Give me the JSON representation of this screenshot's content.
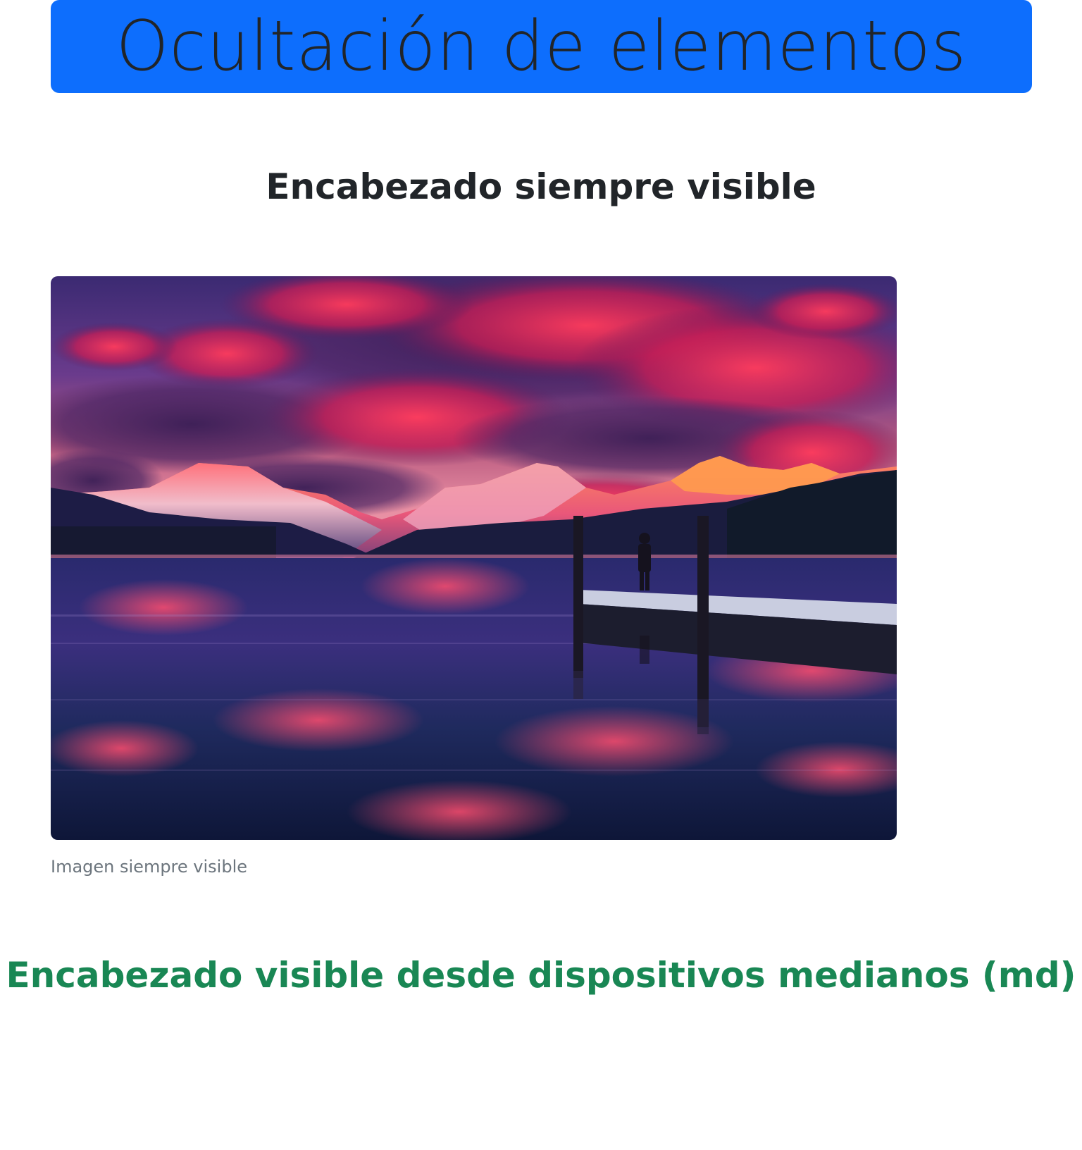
{
  "banner": {
    "title": "Ocultación de elementos",
    "background_color": "#0d6efd"
  },
  "heading_always": {
    "text": "Encabezado siempre visible"
  },
  "image_block": {
    "image_subject": "sunset-lake-mountains-pier-photo",
    "caption": "Imagen siempre visible"
  },
  "heading_md": {
    "text": "Encabezado visible desde dispositivos medianos (md)",
    "color": "#198754"
  },
  "colors": {
    "text": "#212529",
    "muted": "#6c757d"
  }
}
